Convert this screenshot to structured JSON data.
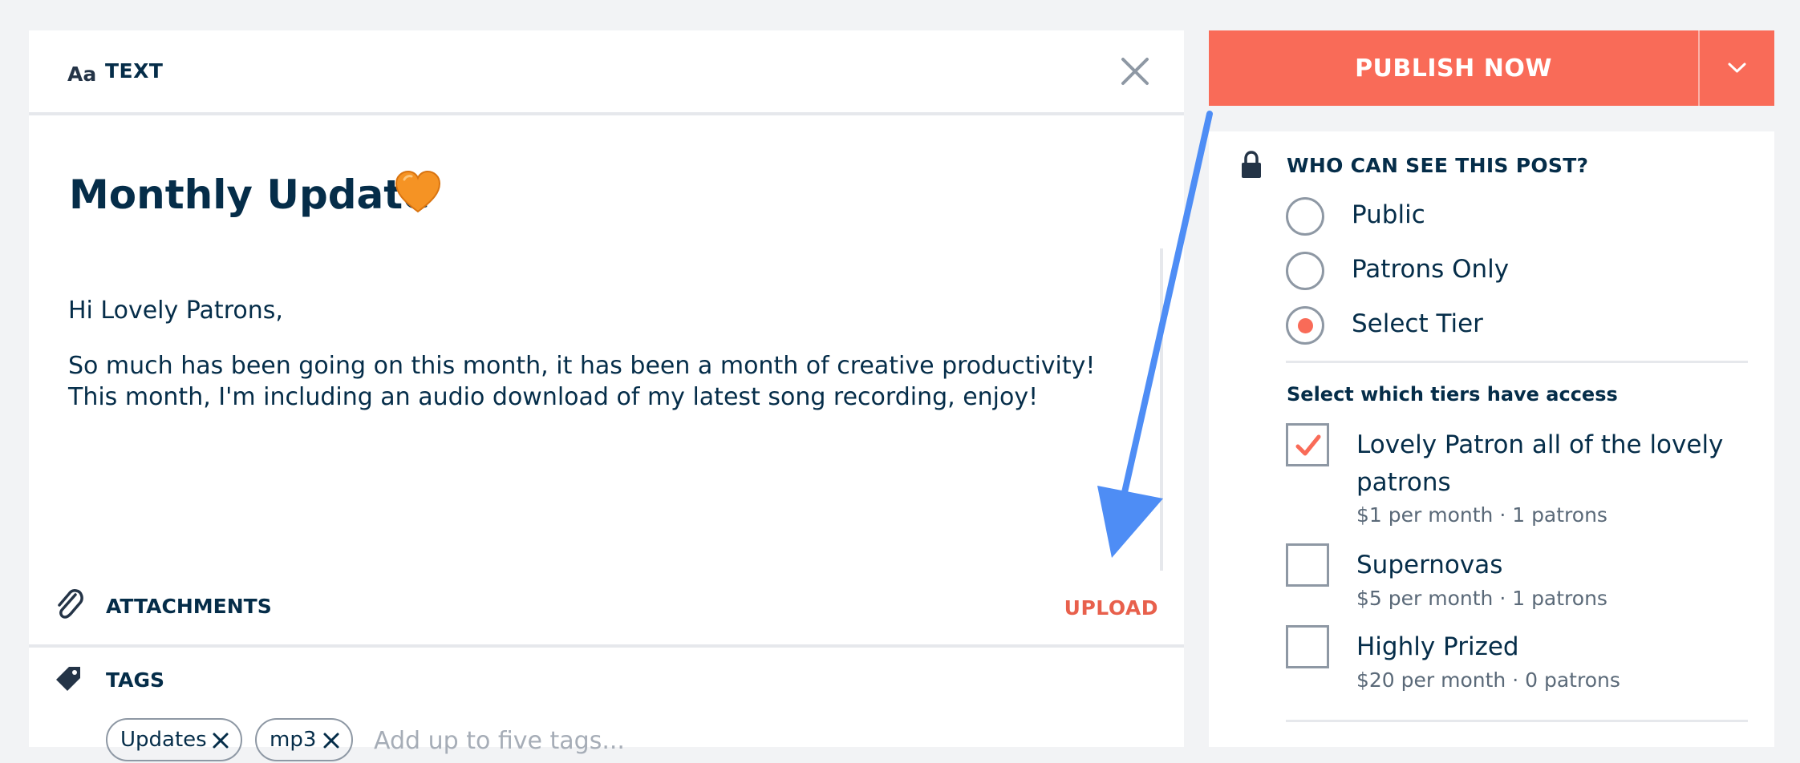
{
  "editor": {
    "type_icon": "Aa",
    "type_label": "TEXT",
    "close_icon": "close-icon",
    "title": "Monthly Update",
    "title_emoji_icon": "orange-heart-icon",
    "body": [
      "Hi Lovely Patrons,",
      "So much has been going on this month, it has been a month of creative productivity! This month, I'm including an audio download of my latest song recording, enjoy!"
    ],
    "attachments_label": "ATTACHMENTS",
    "upload_label": "UPLOAD",
    "tags_label": "TAGS",
    "tags": [
      "Updates",
      "mp3"
    ],
    "tag_placeholder": "Add up to five tags..."
  },
  "publish": {
    "label": "PUBLISH NOW",
    "color": "#f96b58"
  },
  "visibility": {
    "title": "WHO CAN SEE THIS POST?",
    "options": [
      {
        "label": "Public",
        "selected": false
      },
      {
        "label": "Patrons Only",
        "selected": false
      },
      {
        "label": "Select Tier",
        "selected": true
      }
    ],
    "tiers_title": "Select which tiers have access",
    "tiers": [
      {
        "name": "Lovely Patron all of the lovely patrons",
        "meta": "$1 per month · 1 patrons",
        "checked": true
      },
      {
        "name": "Supernovas",
        "meta": "$5 per month · 1 patrons",
        "checked": false
      },
      {
        "name": "Highly Prized",
        "meta": "$20 per month · 0 patrons",
        "checked": false
      }
    ]
  },
  "annotation": {
    "arrow_color": "#4e8df5"
  },
  "colors": {
    "accent": "#f96b58",
    "text": "#052d49",
    "muted": "#5a6978"
  }
}
